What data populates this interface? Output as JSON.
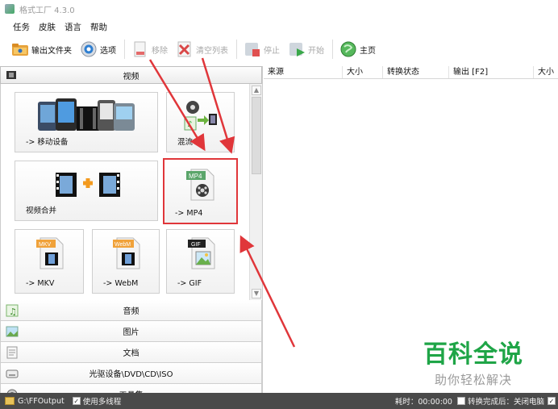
{
  "window": {
    "title": "格式工厂 4.3.0"
  },
  "menu": [
    "任务",
    "皮肤",
    "语言",
    "帮助"
  ],
  "toolbar": {
    "output_folder": "输出文件夹",
    "options": "选项",
    "remove": "移除",
    "clear_list": "清空列表",
    "stop": "停止",
    "start": "开始",
    "home": "主页"
  },
  "categories": {
    "video": "视频",
    "audio": "音频",
    "image": "图片",
    "document": "文档",
    "disc": "光驱设备\\DVD\\CD\\ISO",
    "tools": "工具集"
  },
  "video_tiles": [
    {
      "label": "-> 移动设备",
      "icon": "mobile-devices-icon"
    },
    {
      "label": "混流",
      "icon": "mux-icon"
    },
    {
      "label": "视频合并",
      "icon": "video-join-icon"
    },
    {
      "label": "-> MP4",
      "icon": "mp4-file-icon",
      "badge": "MP4",
      "selected": true
    },
    {
      "label": "-> MKV",
      "icon": "mkv-file-icon",
      "badge": "MKV"
    },
    {
      "label": "-> WebM",
      "icon": "webm-file-icon",
      "badge": "WebM"
    },
    {
      "label": "-> GIF",
      "icon": "gif-file-icon",
      "badge": "GIF"
    }
  ],
  "task_columns": [
    "来源",
    "大小",
    "转换状态",
    "输出 [F2]",
    "大小"
  ],
  "watermark": {
    "title": "百科全说",
    "subtitle": "助你轻松解决"
  },
  "status": {
    "output_path": "G:\\FFOutput",
    "multithread": "使用多线程",
    "elapsed": "耗时：00:00:00",
    "after_done": "转换完成后：关闭电脑"
  },
  "colors": {
    "accent_red": "#e0363a",
    "watermark_green": "#1fa547"
  }
}
